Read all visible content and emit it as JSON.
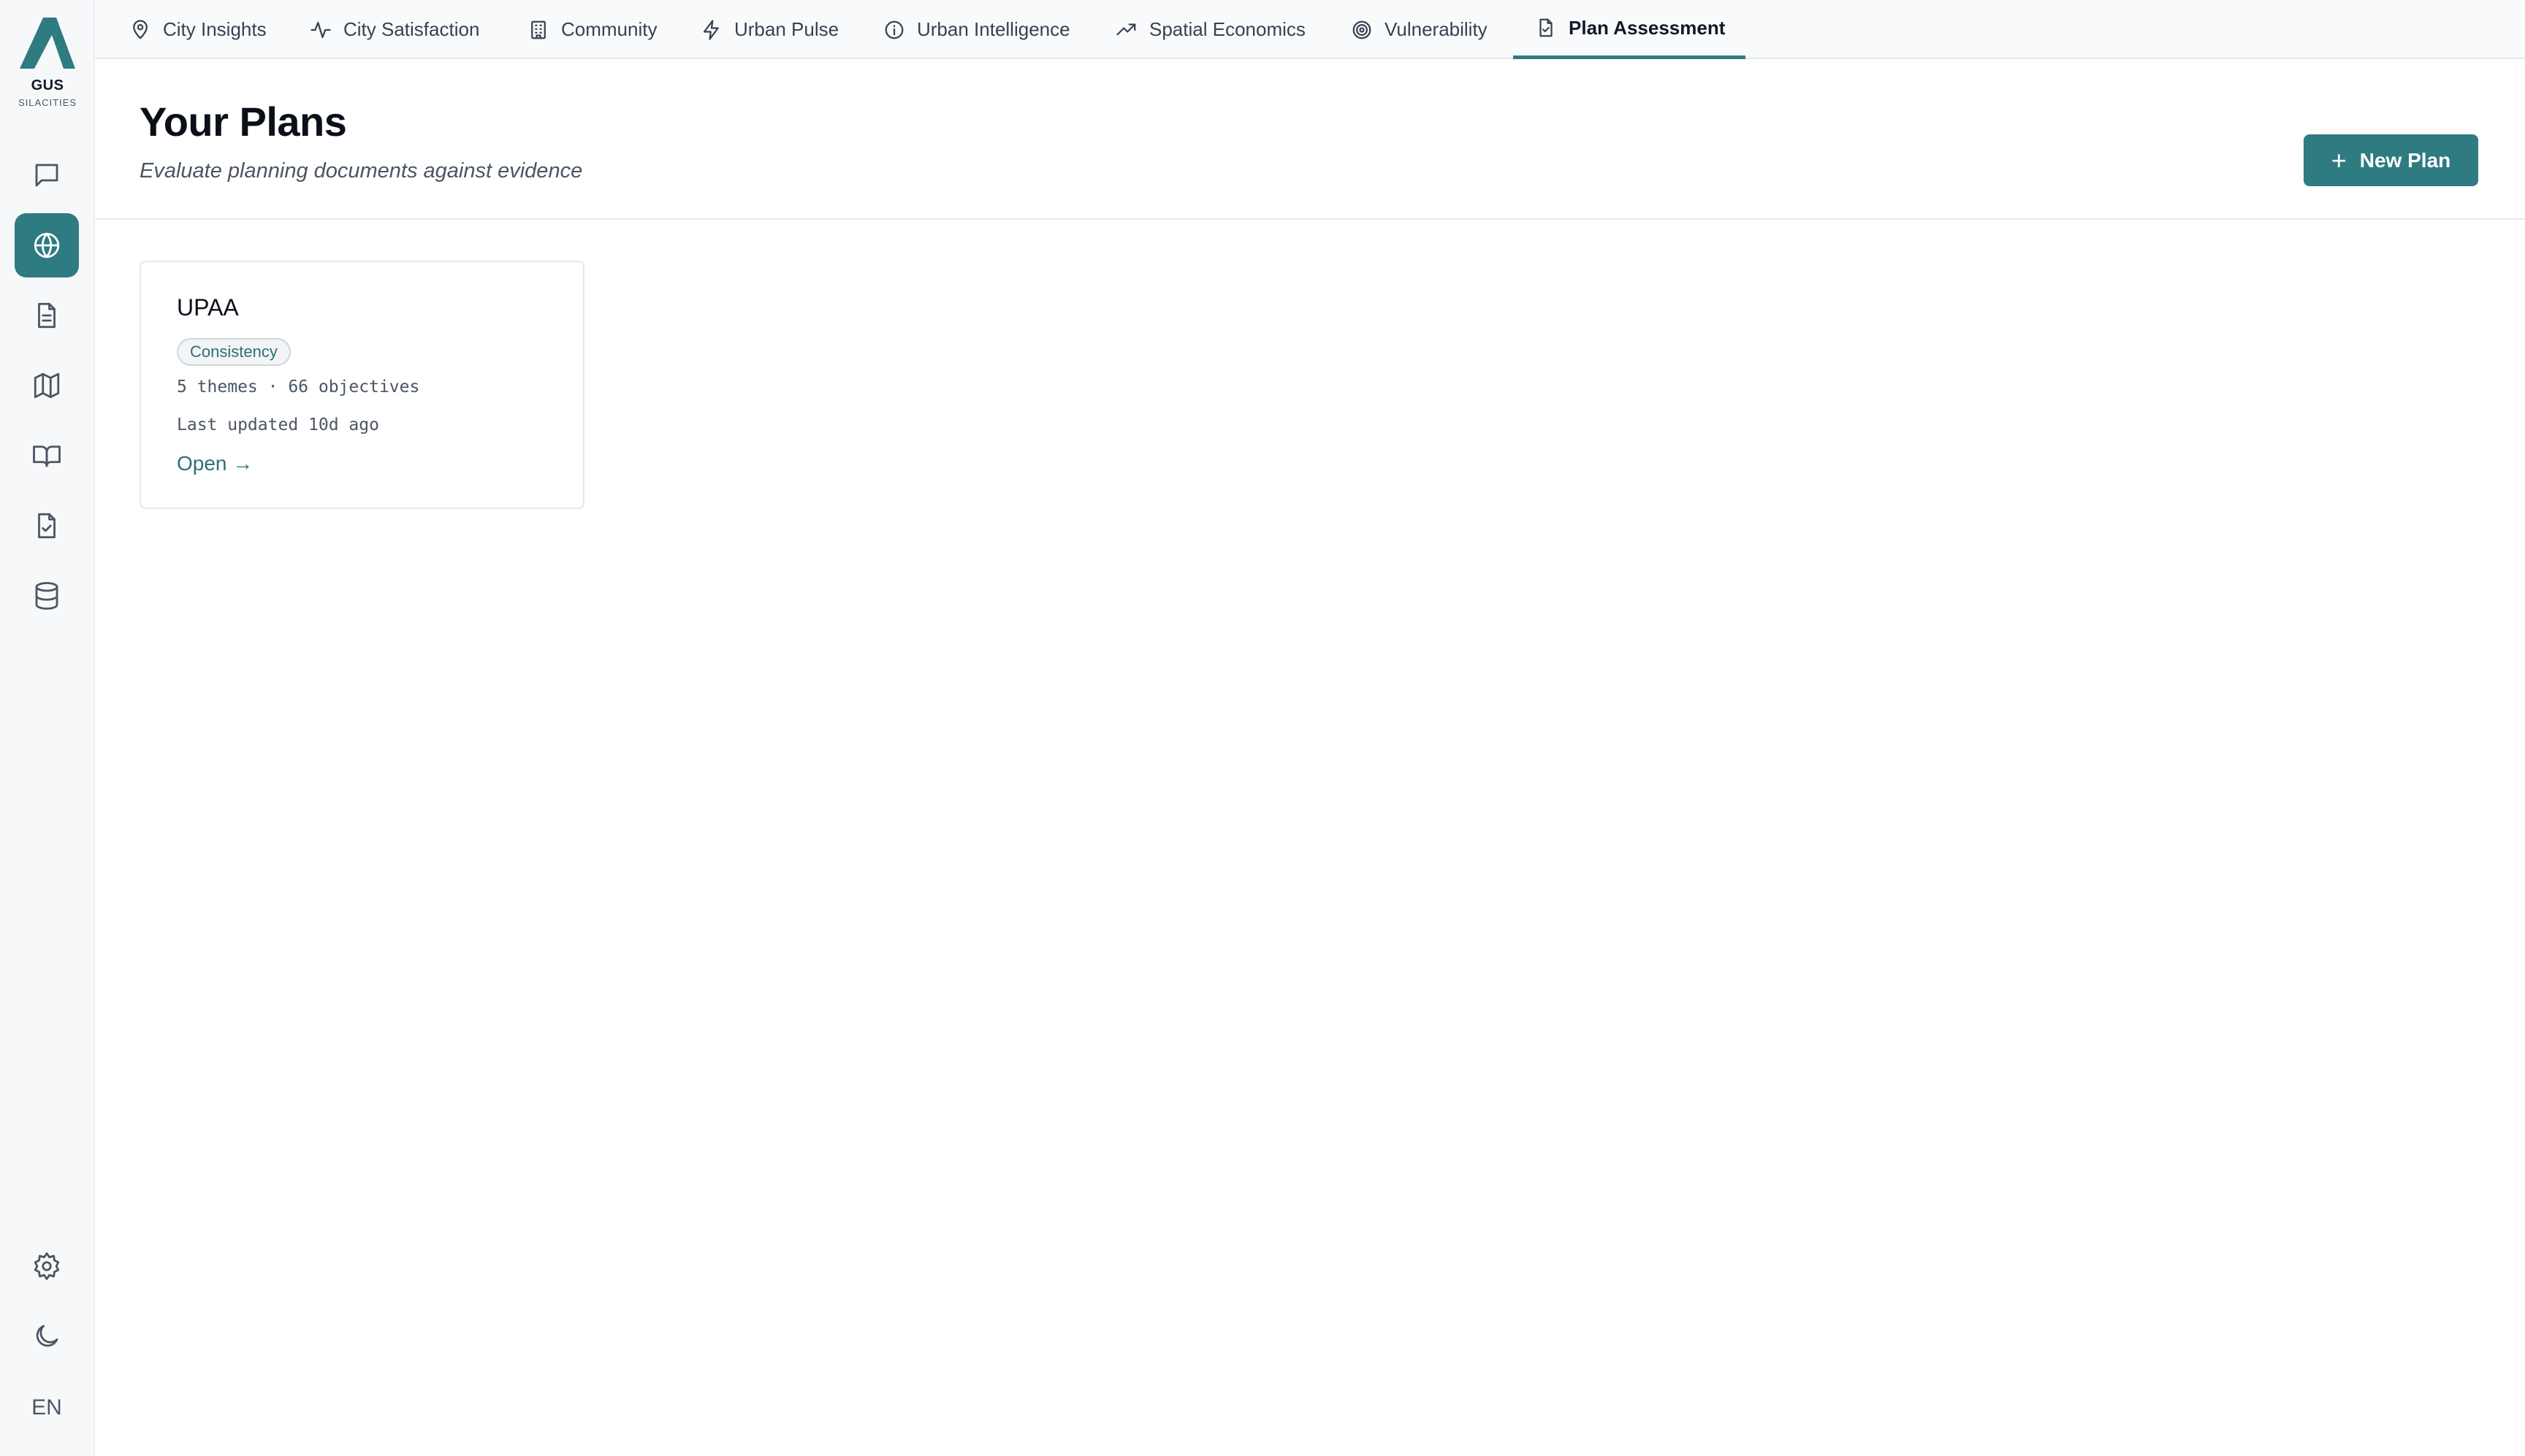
{
  "brand": {
    "name": "GUS",
    "sub": "SILACITIES"
  },
  "nav": {
    "tabs": [
      {
        "label": "City Insights",
        "icon": "map-pin-icon"
      },
      {
        "label": "City Satisfaction",
        "icon": "activity-icon"
      },
      {
        "label": "Community",
        "icon": "building-icon"
      },
      {
        "label": "Urban Pulse",
        "icon": "lightning-icon"
      },
      {
        "label": "Urban Intelligence",
        "icon": "info-icon"
      },
      {
        "label": "Spatial Economics",
        "icon": "trending-up-icon"
      },
      {
        "label": "Vulnerability",
        "icon": "target-icon"
      },
      {
        "label": "Plan Assessment",
        "icon": "file-check-icon"
      }
    ],
    "active": "Plan Assessment"
  },
  "sidebar": {
    "items": [
      {
        "icon": "chat-icon"
      },
      {
        "icon": "globe-icon",
        "active": true
      },
      {
        "icon": "document-icon"
      },
      {
        "icon": "map-icon"
      },
      {
        "icon": "book-icon"
      },
      {
        "icon": "file-check-icon"
      },
      {
        "icon": "database-icon"
      }
    ],
    "bottom": [
      {
        "icon": "gear-icon"
      },
      {
        "icon": "moon-icon"
      }
    ],
    "language": "EN"
  },
  "header": {
    "title": "Your Plans",
    "subtitle": "Evaluate planning documents against evidence",
    "new_button": "New Plan"
  },
  "plans": [
    {
      "title": "UPAA",
      "badge": "Consistency",
      "stats": "5 themes · 66 objectives",
      "updated": "Last updated 10d ago",
      "open_label": "Open →"
    }
  ],
  "colors": {
    "accent": "#2f7b82"
  }
}
